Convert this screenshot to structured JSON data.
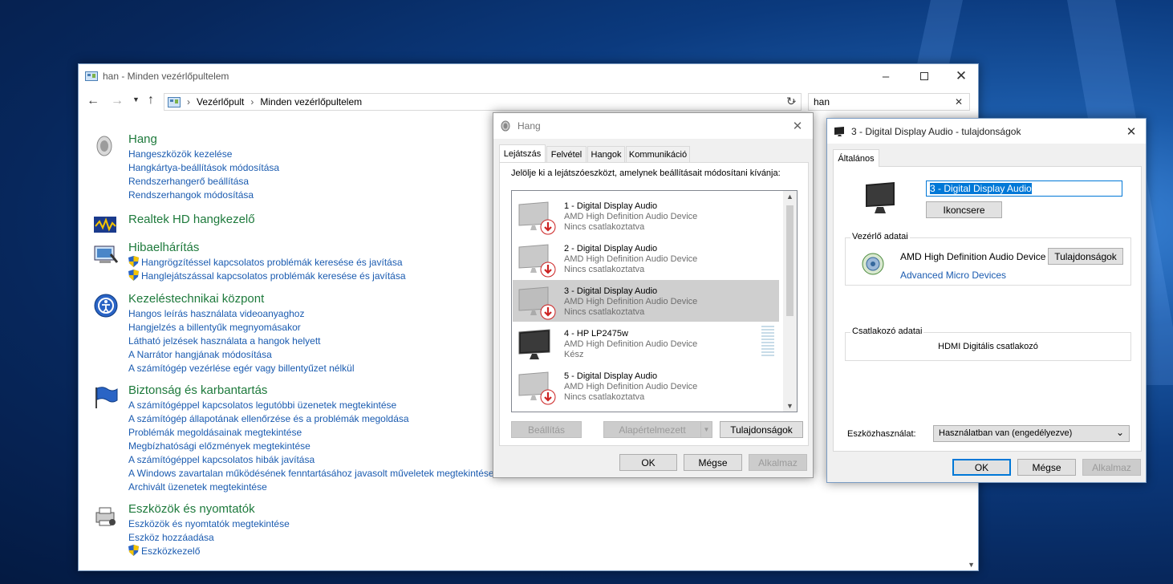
{
  "colors": {
    "link": "#1a5bb0",
    "category": "#1e7a3c",
    "accent": "#0078d7"
  },
  "cp": {
    "title": "han - Minden vezérlőpultelem",
    "breadcrumb": [
      "Vezérlőpult",
      "Minden vezérlőpultelem"
    ],
    "search_value": "han",
    "categories": [
      {
        "title": "Hang",
        "icon": "speaker-icon",
        "links": [
          "Hangeszközök kezelése",
          "Hangkártya-beállítások módosítása",
          "Rendszerhangerő beállítása",
          "Rendszerhangok módosítása"
        ]
      },
      {
        "title": "Realtek HD hangkezelő",
        "icon": "realtek-icon",
        "links": []
      },
      {
        "title": "Hibaelhárítás",
        "icon": "troubleshoot-icon",
        "links": [
          "Hangrögzítéssel kapcsolatos problémák keresése és javítása",
          "Hanglejátszással kapcsolatos problémák keresése és javítása"
        ]
      },
      {
        "title": "Kezeléstechnikai központ",
        "icon": "ease-of-access-icon",
        "links": [
          "Hangos leírás használata videoanyaghoz",
          "Hangjelzés a billentyűk megnyomásakor",
          "Látható jelzések használata a hangok helyett",
          "A Narrátor hangjának módosítása",
          "A számítógép vezérlése egér vagy billentyűzet nélkül"
        ]
      },
      {
        "title": "Biztonság és karbantartás",
        "icon": "flag-icon",
        "links": [
          "A számítógéppel kapcsolatos legutóbbi üzenetek megtekintése",
          "A számítógép állapotának ellenőrzése és a problémák megoldása",
          "Problémák megoldásainak megtekintése",
          "Megbízhatósági előzmények megtekintése",
          "A számítógéppel kapcsolatos hibák javítása",
          "A Windows zavartalan működésének fenntartásához javasolt műveletek megtekintése",
          "Archivált üzenetek megtekintése"
        ]
      },
      {
        "title": "Eszközök és nyomtatók",
        "icon": "printer-icon",
        "links": [
          "Eszközök és nyomtatók megtekintése",
          "Eszköz hozzáadása",
          "Eszközkezelő"
        ]
      }
    ]
  },
  "hang": {
    "title": "Hang",
    "tabs": [
      "Lejátszás",
      "Felvétel",
      "Hangok",
      "Kommunikáció"
    ],
    "instruction": "Jelölje ki a lejátszóeszközt, amelynek beállításait módosítani kívánja:",
    "devices": [
      {
        "name": "1 - Digital Display Audio",
        "driver": "AMD High Definition Audio Device",
        "status": "Nincs csatlakoztatva"
      },
      {
        "name": "2 - Digital Display Audio",
        "driver": "AMD High Definition Audio Device",
        "status": "Nincs csatlakoztatva"
      },
      {
        "name": "3 - Digital Display Audio",
        "driver": "AMD High Definition Audio Device",
        "status": "Nincs csatlakoztatva"
      },
      {
        "name": "4 - HP LP2475w",
        "driver": "AMD High Definition Audio Device",
        "status": "Kész"
      },
      {
        "name": "5 - Digital Display Audio",
        "driver": "AMD High Definition Audio Device",
        "status": "Nincs csatlakoztatva"
      }
    ],
    "btn_configure": "Beállítás",
    "btn_default": "Alapértelmezett",
    "btn_properties": "Tulajdonságok",
    "btn_ok": "OK",
    "btn_cancel": "Mégse",
    "btn_apply": "Alkalmaz"
  },
  "props": {
    "title": "3 - Digital Display Audio - tulajdonságok",
    "tab": "Általános",
    "name_value": "3 - Digital Display Audio",
    "btn_change_icon": "Ikoncsere",
    "controller_label": "Vezérlő adatai",
    "controller_name": "AMD High Definition Audio Device",
    "controller_vendor": "Advanced Micro Devices",
    "btn_properties": "Tulajdonságok",
    "jack_label": "Csatlakozó adatai",
    "jack_value": "HDMI Digitális csatlakozó",
    "usage_label": "Eszközhasználat:",
    "usage_value": "Használatban van (engedélyezve)",
    "btn_ok": "OK",
    "btn_cancel": "Mégse",
    "btn_apply": "Alkalmaz"
  }
}
